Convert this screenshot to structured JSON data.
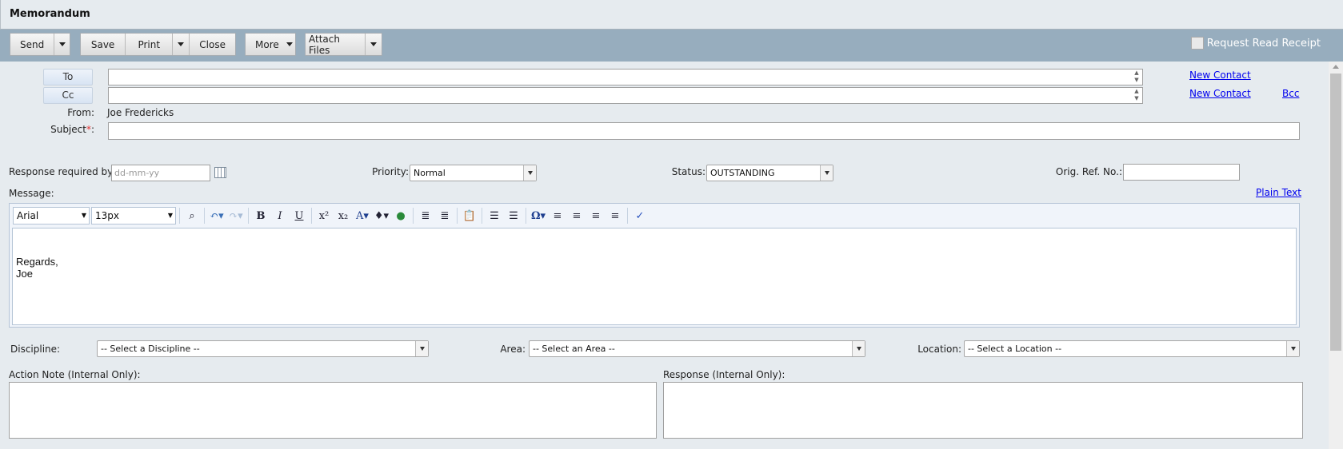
{
  "window": {
    "title": "Memorandum"
  },
  "toolbar": {
    "send": "Send",
    "save": "Save",
    "print": "Print",
    "close": "Close",
    "more": "More",
    "attach": "Attach Files",
    "request_read_receipt": "Request Read Receipt",
    "request_read_receipt_checked": false
  },
  "recipients": {
    "to_label": "To",
    "cc_label": "Cc",
    "to_value": "",
    "cc_value": "",
    "new_contact": "New Contact",
    "bcc": "Bcc",
    "from_label": "From:",
    "from_value": "Joe Fredericks",
    "subject_label": "Subject",
    "required_mark": "*",
    "colon": ":",
    "subject_value": ""
  },
  "meta": {
    "response_label": "Response required by:",
    "date_placeholder": "dd-mm-yy",
    "priority_label": "Priority:",
    "priority_value": "Normal",
    "status_label": "Status:",
    "status_value": "OUTSTANDING",
    "orig_ref_label": "Orig. Ref. No.:",
    "orig_ref_value": ""
  },
  "message": {
    "label": "Message:",
    "plain_text": "Plain Text",
    "font": "Arial",
    "size": "13px",
    "body_lines": [
      "Regards,",
      "Joe"
    ]
  },
  "classification": {
    "discipline_label": "Discipline:",
    "discipline_value": "-- Select a Discipline --",
    "area_label": "Area:",
    "area_value": "-- Select an Area --",
    "location_label": "Location:",
    "location_value": "-- Select a Location --"
  },
  "notes": {
    "action_note_label": "Action Note (Internal Only):",
    "response_label": "Response (Internal Only):"
  },
  "colors": {
    "toolbar_bg": "#97adbe",
    "page_bg": "#e6ebef",
    "link": "#0000ee",
    "required": "#e53333"
  }
}
